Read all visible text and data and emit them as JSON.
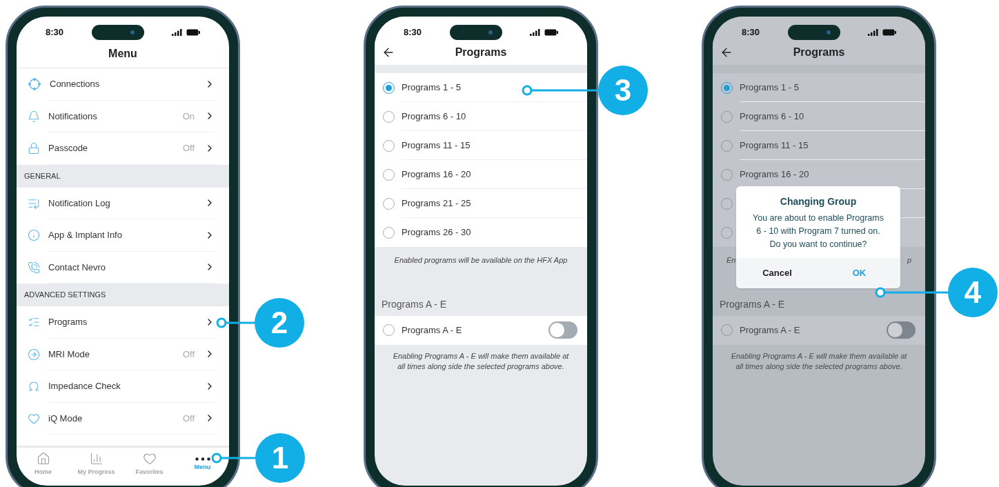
{
  "phones": [
    {
      "kind": "menu",
      "time": "8:30",
      "title": "Menu",
      "groups": [
        {
          "items": [
            {
              "label": "Connections"
            },
            {
              "label": "Notifications",
              "value": "On"
            },
            {
              "label": "Passcode",
              "value": "Off"
            }
          ]
        },
        {
          "header": "GENERAL",
          "items": [
            {
              "label": "Notification Log"
            },
            {
              "label": "App & Implant Info"
            },
            {
              "label": "Contact Nevro"
            }
          ]
        },
        {
          "header": "ADVANCED SETTINGS",
          "items": [
            {
              "label": "Programs"
            },
            {
              "label": "MRI Mode",
              "value": "Off"
            },
            {
              "label": "Impedance Check"
            },
            {
              "label": "iQ Mode",
              "value": "Off"
            }
          ]
        }
      ],
      "tabs": [
        {
          "label": "Home",
          "selected": false
        },
        {
          "label": "My Progress",
          "selected": false
        },
        {
          "label": "Favorites",
          "selected": false
        },
        {
          "label": "Menu",
          "selected": true
        }
      ]
    },
    {
      "kind": "programs",
      "time": "8:30",
      "title": "Programs",
      "dimmed": false,
      "options": [
        {
          "label": "Programs 1 - 5",
          "selected": true
        },
        {
          "label": "Programs 6 - 10",
          "selected": false
        },
        {
          "label": "Programs 11 - 15",
          "selected": false
        },
        {
          "label": "Programs 16 - 20",
          "selected": false
        },
        {
          "label": "Programs 21 - 25",
          "selected": false
        },
        {
          "label": "Programs 26 - 30",
          "selected": false
        }
      ],
      "note": "Enabled programs will be available on the HFX App",
      "section_header": "Programs A - E",
      "toggle_row": {
        "label": "Programs A - E",
        "selected": false,
        "on": false
      },
      "footnote": "Enabling Programs A - E will make them available at all times along side the selected programs above."
    },
    {
      "kind": "programs",
      "time": "8:30",
      "title": "Programs",
      "dimmed": true,
      "options": [
        {
          "label": "Programs 1 - 5",
          "selected": true
        },
        {
          "label": "Programs 6 - 10",
          "selected": false
        },
        {
          "label": "Programs 11 - 15",
          "selected": false
        },
        {
          "label": "Programs 16 - 20",
          "selected": false
        },
        {
          "selected": false
        },
        {
          "selected": false
        }
      ],
      "note_fragments": [
        "En",
        "p"
      ],
      "section_header": "Programs A - E",
      "toggle_row": {
        "label": "Programs A - E",
        "selected": false,
        "on": false
      },
      "footnote": "Enabling Programs A - E will make them available at all times along side the selected programs above.",
      "dialog": {
        "title": "Changing Group",
        "message": "You are about to enable Programs 6 - 10 with Program 7 turned on. Do you want to continue?",
        "buttons": [
          "Cancel",
          "OK"
        ]
      }
    }
  ],
  "callouts": [
    {
      "number": "1"
    },
    {
      "number": "2"
    },
    {
      "number": "3"
    },
    {
      "number": "4"
    }
  ]
}
